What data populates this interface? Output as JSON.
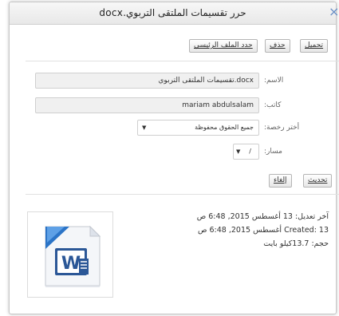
{
  "dialog": {
    "title": "حرر تقسيمات الملتقى التربوي.docx",
    "close_glyph": "×"
  },
  "toolbar": {
    "download_label": "تحميل",
    "delete_label": "حذف",
    "set_main_label": "حدد الملف الرئيسي"
  },
  "form": {
    "name_label": "الاسم:",
    "name_value": "تقسيمات الملتقى التربوي.docx",
    "author_label": "كاتب:",
    "author_value": "mariam abdulsalam",
    "license_label": "أختر رخصة:",
    "license_value": "جميع الحقوق محفوظة",
    "path_label": "مسار:",
    "path_value": "/"
  },
  "actions": {
    "update_label": "تحديث",
    "cancel_label": "إلغاء"
  },
  "file_info": {
    "modified": "آخر تعديل: 13 أغسطس 2015, 6:48 ص",
    "created": "Created: 13 أغسطس 2015, 6:48 ص",
    "size": "حجم: 13.7كيلو بايت"
  },
  "icons": {
    "close": "close-icon",
    "file": "word-document-icon"
  },
  "colors": {
    "accent": "#6a8fc6",
    "word_blue": "#2b5797"
  }
}
